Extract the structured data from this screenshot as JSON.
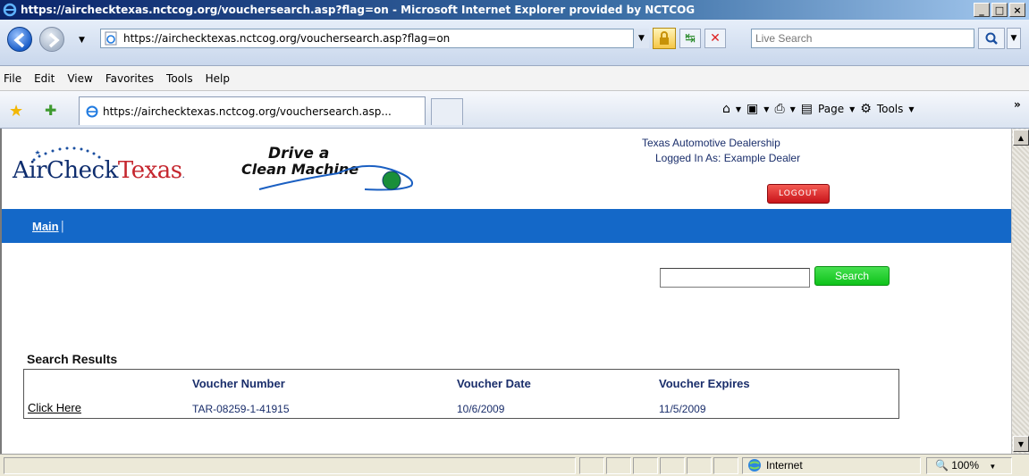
{
  "window": {
    "title": "https://airchecktexas.nctcog.org/vouchersearch.asp?flag=on - Microsoft Internet Explorer provided by NCTCOG",
    "minimize": "_",
    "maximize": "□",
    "close": "×"
  },
  "address": {
    "url": "https://airchecktexas.nctcog.org/vouchersearch.asp?flag=on",
    "live_search_placeholder": "Live Search"
  },
  "menu": [
    "File",
    "Edit",
    "View",
    "Favorites",
    "Tools",
    "Help"
  ],
  "tab": {
    "title": "https://airchecktexas.nctcog.org/vouchersearch.asp..."
  },
  "command_bar": {
    "page_label": "Page",
    "tools_label": "Tools"
  },
  "page": {
    "logo_aircheck_main": "AirCheck",
    "logo_aircheck_red": "Texas",
    "logo_drive_line1": "Drive a",
    "logo_drive_line2": "Clean Machine",
    "dealer_name": "Texas Automotive Dealership",
    "logged_in": "Logged In As: Example Dealer",
    "logout_label": "LOGOUT",
    "nav_main": "Main",
    "nav_sep": "|",
    "search_value": "",
    "search_button": "Search",
    "results_title": "Search Results",
    "results_columns": [
      "Voucher Number",
      "Voucher Date",
      "Voucher Expires"
    ],
    "results_rows": [
      {
        "link": "Click Here",
        "voucher_number": "TAR-08259-1-41915",
        "voucher_date": "10/6/2009",
        "voucher_expires": "11/5/2009"
      }
    ]
  },
  "status": {
    "zone": "Internet",
    "zoom": "100%"
  },
  "colors": {
    "nav_bar": "#1468c8",
    "logout": "#d8221f",
    "search_button": "#22cc2c",
    "aircheck_blue": "#0e2d6e",
    "aircheck_red": "#c5262e"
  }
}
